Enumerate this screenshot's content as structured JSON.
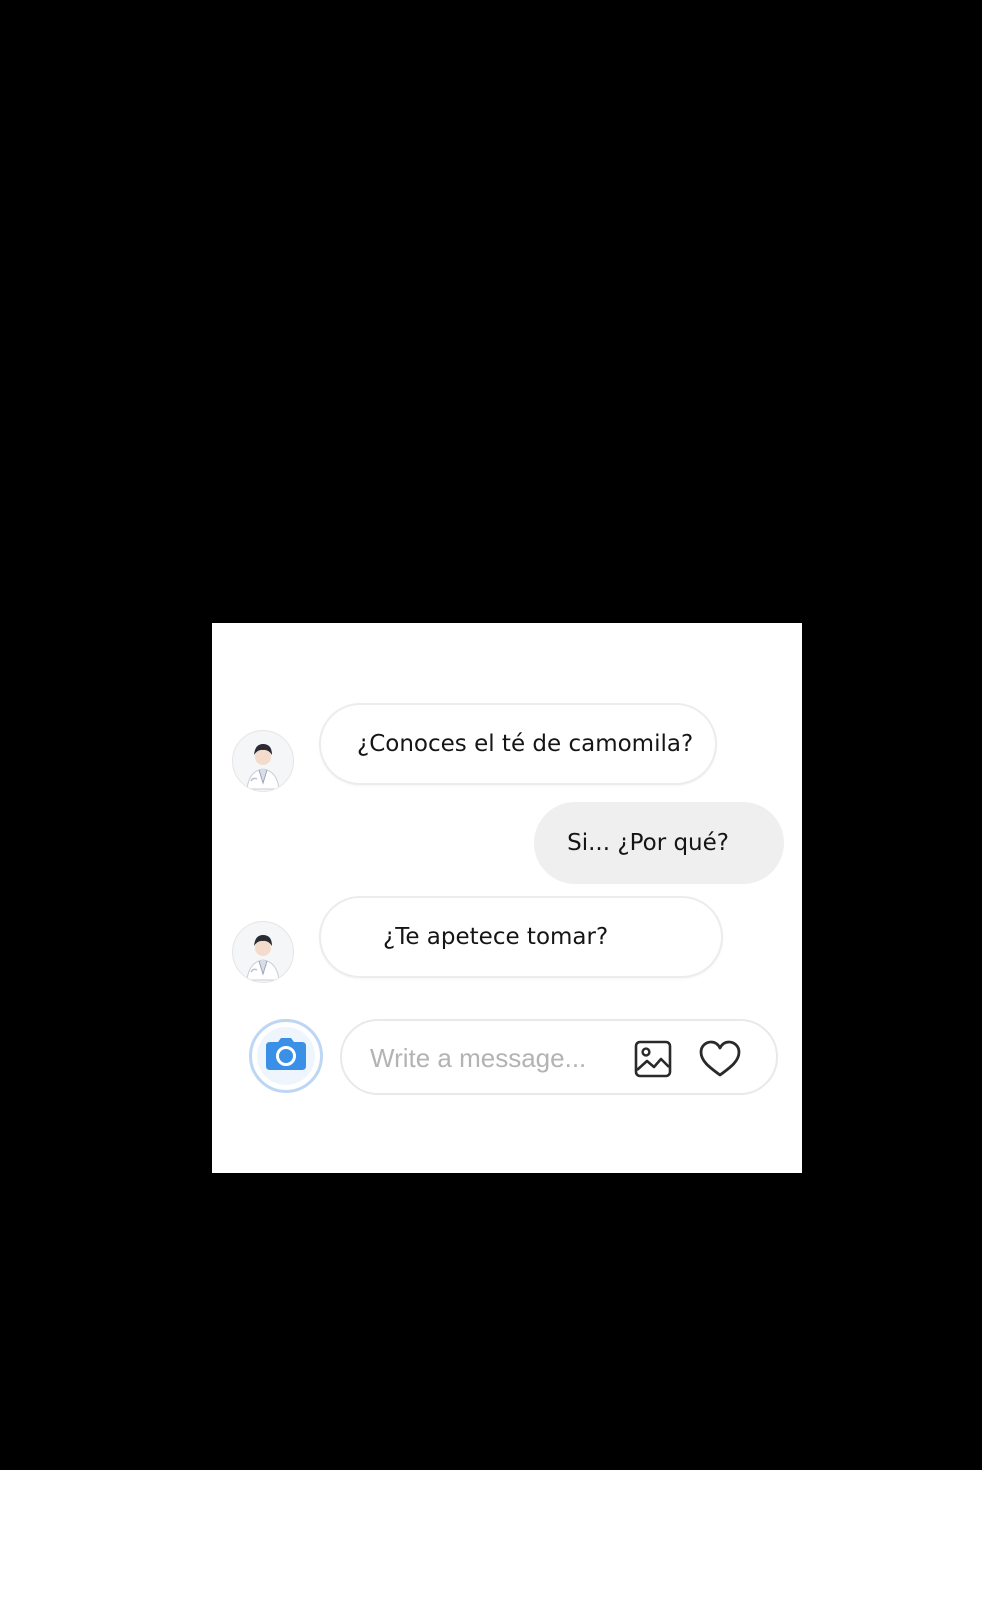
{
  "messages": [
    {
      "from": "contact",
      "text": "¿Conoces el té de camomila?"
    },
    {
      "from": "me",
      "text": "Si... ¿Por qué?"
    },
    {
      "from": "contact",
      "text": "¿Te apetece tomar?"
    }
  ],
  "composer": {
    "placeholder": "Write a message...",
    "camera_icon": "camera-icon",
    "image_icon": "image-icon",
    "heart_icon": "heart-icon"
  },
  "colors": {
    "backdrop": "#000000",
    "card": "#ffffff",
    "outgoing_bubble": "#efefef",
    "camera_accent": "#3a8fe6"
  }
}
